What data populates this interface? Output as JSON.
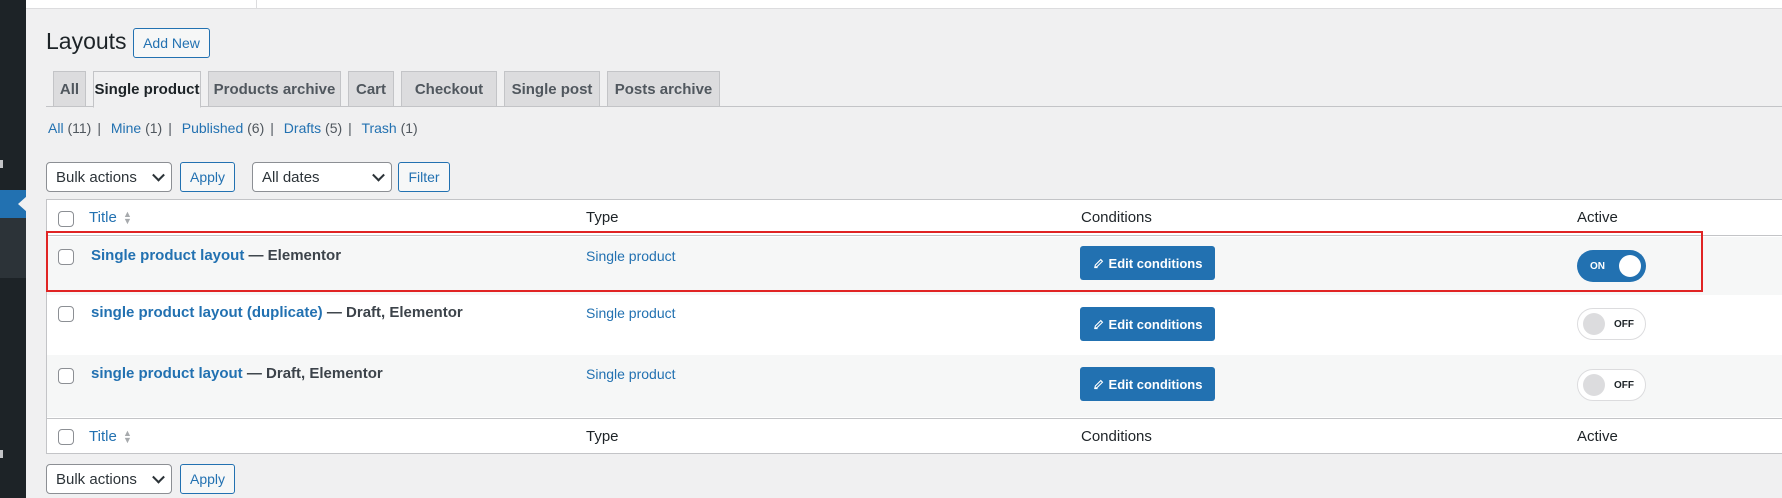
{
  "page": {
    "title": "Layouts",
    "add_new": "Add New"
  },
  "tabs": [
    {
      "label": "All",
      "active": false
    },
    {
      "label": "Single product",
      "active": true
    },
    {
      "label": "Products archive",
      "active": false
    },
    {
      "label": "Cart",
      "active": false
    },
    {
      "label": "Checkout",
      "active": false
    },
    {
      "label": "Single post",
      "active": false
    },
    {
      "label": "Posts archive",
      "active": false
    }
  ],
  "views": {
    "all": {
      "label": "All",
      "count": "(11)"
    },
    "mine": {
      "label": "Mine",
      "count": "(1)"
    },
    "published": {
      "label": "Published",
      "count": "(6)"
    },
    "drafts": {
      "label": "Drafts",
      "count": "(5)"
    },
    "trash": {
      "label": "Trash",
      "count": "(1)"
    },
    "separator": "|"
  },
  "filters": {
    "bulk_actions": "Bulk actions",
    "apply": "Apply",
    "dates": "All dates",
    "filter": "Filter"
  },
  "table": {
    "columns": {
      "title": "Title",
      "type": "Type",
      "conditions": "Conditions",
      "active": "Active"
    },
    "rows": [
      {
        "title": "Single product layout",
        "suffix": " — Elementor",
        "type": "Single product",
        "edit": "Edit conditions",
        "toggle": "ON",
        "active": true
      },
      {
        "title": "single product layout (duplicate)",
        "suffix": " — Draft, Elementor",
        "type": "Single product",
        "edit": "Edit conditions",
        "toggle": "OFF",
        "active": false
      },
      {
        "title": "single product layout",
        "suffix": " — Draft, Elementor",
        "type": "Single product",
        "edit": "Edit conditions",
        "toggle": "OFF",
        "active": false
      }
    ]
  },
  "bottom": {
    "bulk_actions": "Bulk actions",
    "apply": "Apply"
  },
  "colors": {
    "accent": "#2271b1",
    "highlight": "#e02424",
    "background": "#f0f0f1"
  }
}
